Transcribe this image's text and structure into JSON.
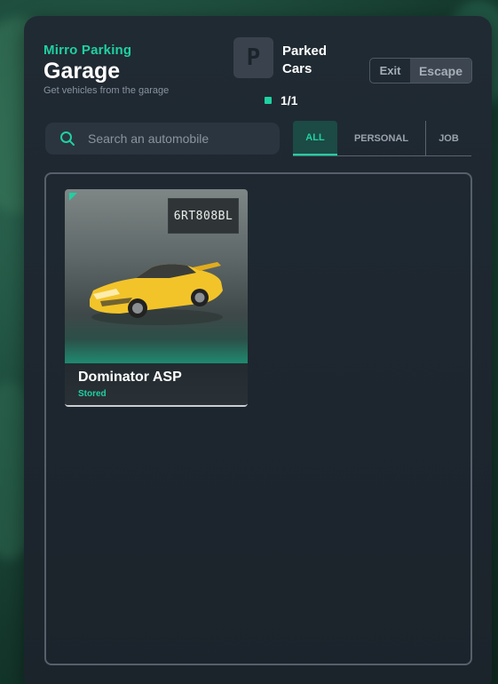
{
  "header": {
    "subtitle": "Mirro Parking",
    "title": "Garage",
    "description": "Get vehicles from the garage"
  },
  "parked": {
    "badge_letter": "P",
    "label": "Parked Cars",
    "count": "1/1"
  },
  "actions": {
    "exit_label": "Exit",
    "escape_label": "Escape"
  },
  "search": {
    "placeholder": "Search an automobile",
    "value": ""
  },
  "tabs": [
    {
      "label": "ALL",
      "active": true
    },
    {
      "label": "PERSONAL",
      "active": false
    },
    {
      "label": "JOB",
      "active": false
    }
  ],
  "vehicles": [
    {
      "name": "Dominator ASP",
      "status": "Stored",
      "plate": "6RT808BL",
      "color": "#f2c42a"
    }
  ],
  "colors": {
    "accent": "#1fd1a2",
    "panel": "#1e272f",
    "active_tab_bg": "#1c4a45"
  },
  "icons": {
    "search": "search-icon",
    "parking": "parking-icon"
  }
}
